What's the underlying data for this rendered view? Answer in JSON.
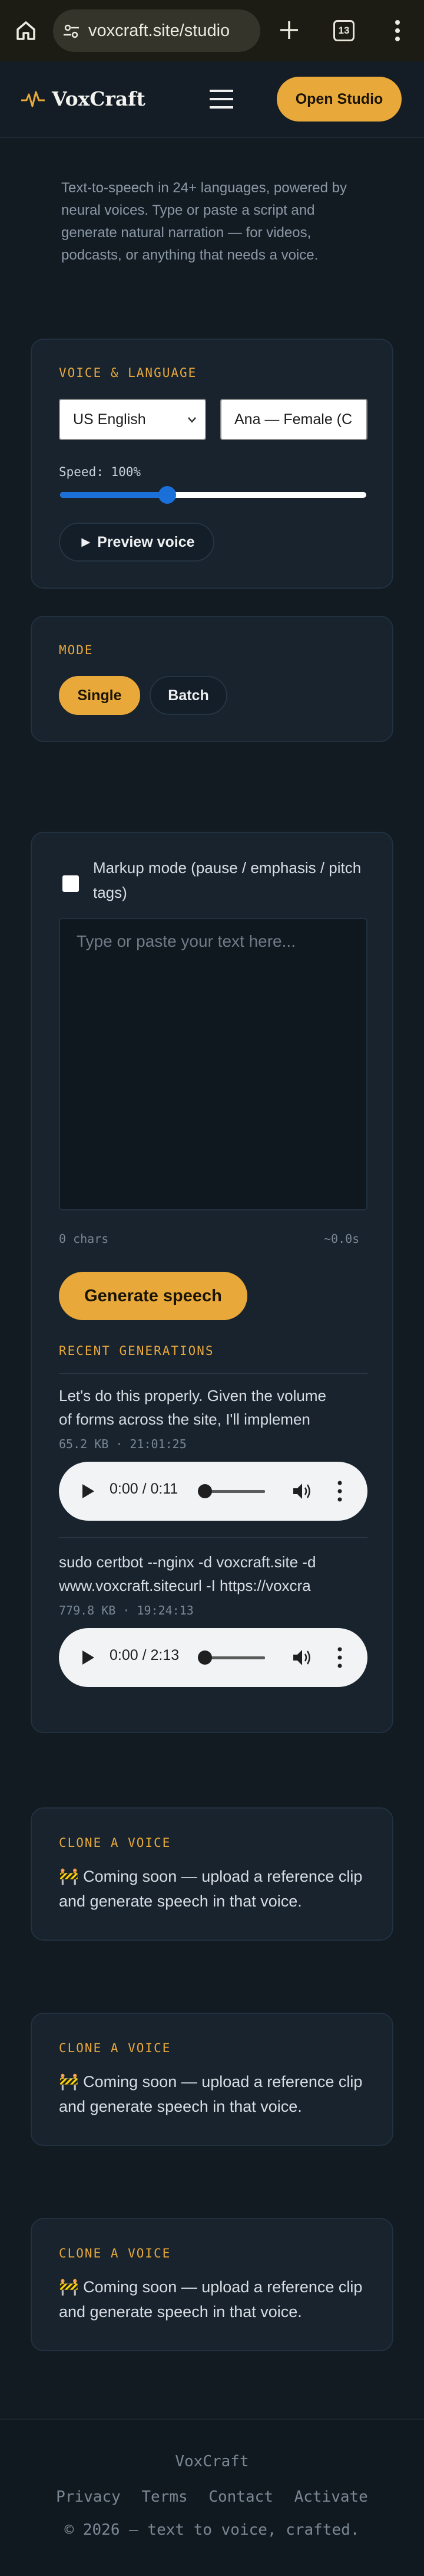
{
  "browser": {
    "url": "voxcraft.site/studio",
    "tab_count": "13"
  },
  "header": {
    "brand": "VoxCraft",
    "cta": "Open Studio"
  },
  "intro": "Text-to-speech in 24+ languages, powered by neural voices. Type or paste a script and generate natural narration — for videos, podcasts, or anything that needs a voice.",
  "voice": {
    "label": "VOICE & LANGUAGE",
    "language": "US English",
    "voice": "Ana — Female (C",
    "speed_label": "Speed: 100%",
    "speed_fraction": 0.35,
    "preview": "► Preview voice"
  },
  "mode": {
    "label": "MODE",
    "options": [
      "Single",
      "Batch"
    ],
    "selected": "Single"
  },
  "editor": {
    "markup_label": "Markup mode (pause / emphasis / pitch tags)",
    "placeholder": "Type or paste your text here...",
    "chars": "0 chars",
    "duration": "~0.0s",
    "generate": "Generate speech"
  },
  "recent": {
    "label": "RECENT GENERATIONS",
    "items": [
      {
        "text_line1": "Let's do this properly. Given the volume",
        "text_line2": "of forms across the site, I'll implemen",
        "meta": "65.2 KB · 21:01:25",
        "time": "0:00 / 0:11"
      },
      {
        "text_line1": "sudo certbot --nginx -d voxcraft.site -d",
        "text_line2": "www.voxcraft.sitecurl -I https://voxcra",
        "meta": "779.8 KB · 19:24:13",
        "time": "0:00 / 2:13"
      }
    ]
  },
  "clone_cards": [
    {
      "label": "CLONE A VOICE",
      "text": "🚧 Coming soon — upload a reference clip and generate speech in that voice."
    },
    {
      "label": "CLONE A VOICE",
      "text": "🚧 Coming soon — upload a reference clip and generate speech in that voice."
    },
    {
      "label": "CLONE A VOICE",
      "text": "🚧 Coming soon — upload a reference clip and generate speech in that voice."
    }
  ],
  "footer": {
    "brand": "VoxCraft",
    "links": [
      "Privacy",
      "Terms",
      "Contact",
      "Activate"
    ],
    "copyright": "© 2026 — text to voice, crafted."
  },
  "colors": {
    "accent": "#e9a93a",
    "background": "#121a22",
    "card": "#18232e",
    "slider": "#1a6fd8"
  }
}
